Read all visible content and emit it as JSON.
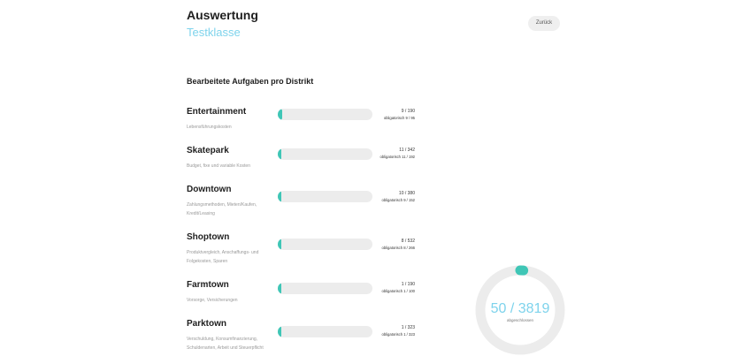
{
  "header": {
    "title": "Auswertung",
    "subtitle": "Testklasse",
    "back_label": "Zurück"
  },
  "section_title": "Bearbeitete Aufgaben pro Distrikt",
  "colors": {
    "accent": "#3fc6b6",
    "subtitle": "#7ed3ec",
    "track": "#ececec"
  },
  "districts": [
    {
      "name": "Entertainment",
      "desc": "Lebensführungskosten",
      "count": "9 / 190",
      "oblig": "obligatorisch 9 / 95",
      "progress": 0.047
    },
    {
      "name": "Skatepark",
      "desc": "Budget, fixe und variable Kosten",
      "count": "11 / 342",
      "oblig": "obligatorisch 11 / 192",
      "progress": 0.032
    },
    {
      "name": "Downtown",
      "desc": "Zahlungsmethoden, Mieten/Kaufen, Kredit/Leasing",
      "count": "10 / 380",
      "oblig": "obligatorisch 9 / 152",
      "progress": 0.026
    },
    {
      "name": "Shoptown",
      "desc": "Produktvergleich, Anschaffungs- und Folgekosten, Sparen",
      "count": "8 / 532",
      "oblig": "obligatorisch 8 / 266",
      "progress": 0.015
    },
    {
      "name": "Farmtown",
      "desc": "Vorsorge, Versicherungen",
      "count": "1 / 190",
      "oblig": "obligatorisch 1 / 100",
      "progress": 0.005
    },
    {
      "name": "Parktown",
      "desc": "Verschuldung, Konsumfinanzierung, Schuldenarten, Arbeit und Steuerpflicht",
      "count": "1 / 323",
      "oblig": "obligatorisch 1 / 323",
      "progress": 0.003
    }
  ],
  "summary": {
    "total": "50 / 3819",
    "label": "abgeschlossen",
    "progress": 0.013
  }
}
